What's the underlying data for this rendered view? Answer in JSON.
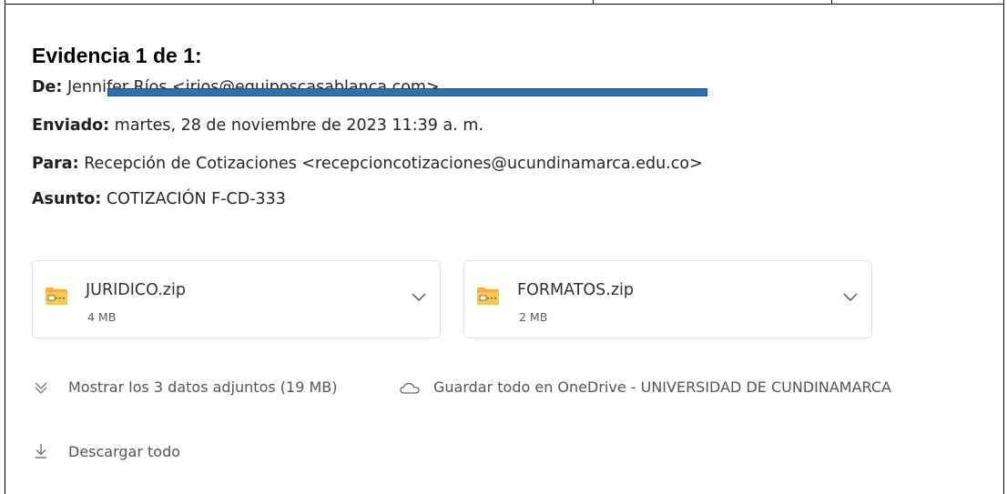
{
  "heading": "Evidencia 1 de 1:",
  "email": {
    "from_label": "De:",
    "from_value": "Jennifer Ríos <jrios@equiposcasablanca.com>",
    "sent_label": "Enviado:",
    "sent_value": "martes, 28 de noviembre de 2023 11:39 a. m.",
    "to_label": "Para:",
    "to_value": "Recepción de Cotizaciones <recepcioncotizaciones@ucundinamarca.edu.co>",
    "subject_label": "Asunto:",
    "subject_value": "COTIZACIÓN F-CD-333"
  },
  "attachments": [
    {
      "name": "JURIDICO.zip",
      "size": "4 MB",
      "icon": "zip-folder-icon"
    },
    {
      "name": "FORMATOS.zip",
      "size": "2 MB",
      "icon": "zip-folder-icon"
    }
  ],
  "actions": {
    "show_all": "Mostrar los 3 datos adjuntos (19 MB)",
    "save_onedrive": "Guardar todo en OneDrive - UNIVERSIDAD DE CUNDINAMARCA",
    "download_all": "Descargar todo"
  },
  "colors": {
    "redaction": "#2e6fb7",
    "zip_folder": "#f2b236"
  }
}
